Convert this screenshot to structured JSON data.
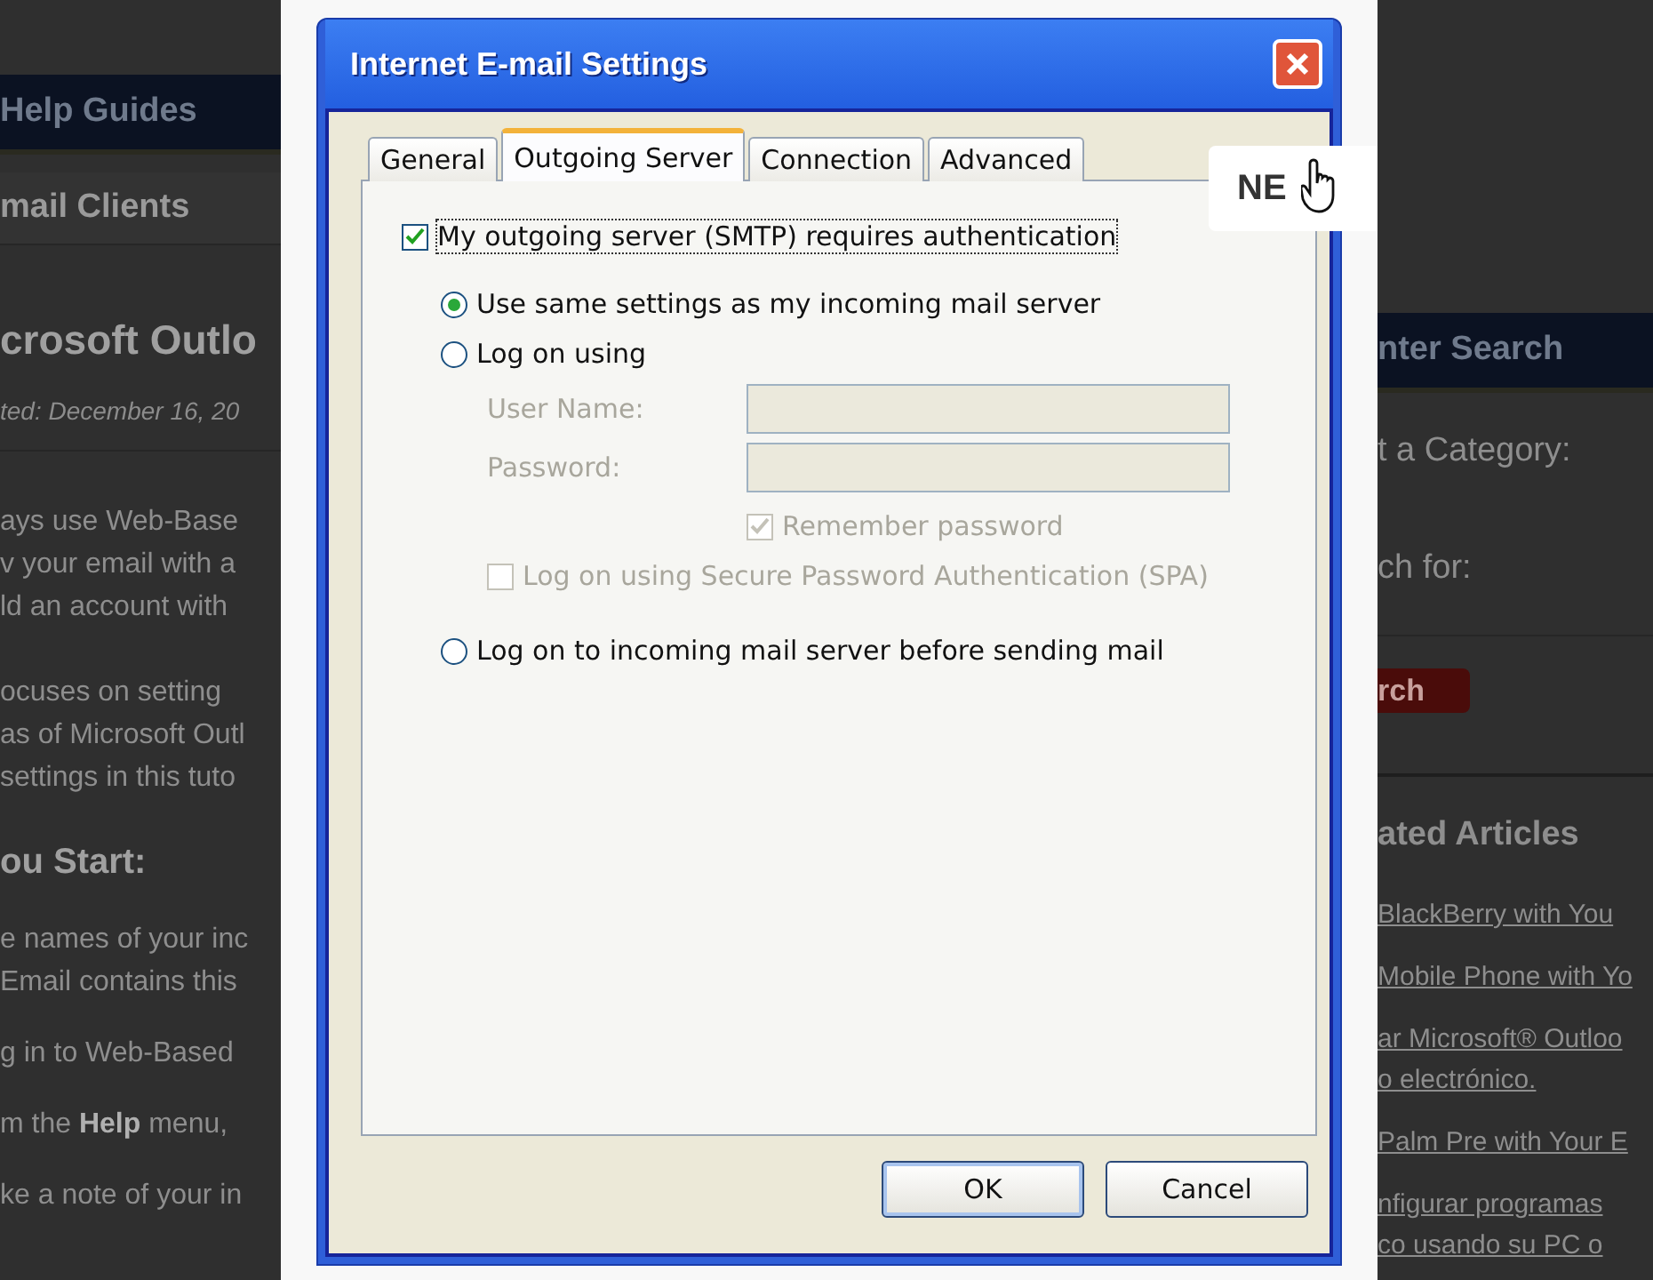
{
  "background_page": {
    "left_column": {
      "header": "Help Guides",
      "section_title": "mail Clients",
      "article_title": "crosoft Outlo",
      "date": "ted: December 16, 20",
      "paragraphs": [
        [
          "ays use Web-Base",
          "v your email with a",
          "ld an account with"
        ],
        [
          "ocuses on setting",
          "as of Microsoft Outl",
          "settings in this tuto"
        ]
      ],
      "heading": "ou Start:",
      "steps": [
        [
          "e names of your inc",
          "Email contains this"
        ],
        [
          "g in to Web-Based"
        ],
        [
          "m the **Help** menu,"
        ],
        [
          "ke a note of your in"
        ]
      ]
    },
    "right_column": {
      "header": "nter Search",
      "category_label": "t a Category:",
      "search_label": "ch for:",
      "search_button": "rch",
      "articles_heading": "ated Articles",
      "articles": [
        [
          "BlackBerry with You"
        ],
        [
          "Mobile Phone with Yo"
        ],
        [
          "ar Microsoft® Outloo",
          "o electrónico."
        ],
        [
          "Palm Pre with Your E"
        ],
        [
          "nfigurar programas",
          "co usando su PC o"
        ]
      ]
    }
  },
  "dialog": {
    "title": "Internet E-mail Settings",
    "tabs": [
      {
        "label": "General",
        "selected": false
      },
      {
        "label": "Outgoing Server",
        "selected": true
      },
      {
        "label": "Connection",
        "selected": false
      },
      {
        "label": "Advanced",
        "selected": false
      }
    ],
    "auth_checkbox": {
      "label": "My outgoing server (SMTP) requires authentication",
      "checked": true
    },
    "logon_options": [
      {
        "label": "Use same settings as my incoming mail server",
        "selected": true
      },
      {
        "label": "Log on using",
        "selected": false
      },
      {
        "label": "Log on to incoming mail server before sending mail",
        "selected": false
      }
    ],
    "credentials": {
      "disabled": true,
      "fields": [
        {
          "label": "User Name:"
        },
        {
          "label": "Password:"
        }
      ],
      "remember": {
        "label": "Remember password",
        "checked": true
      },
      "spa": {
        "label": "Log on using Secure Password Authentication (SPA)",
        "checked": false
      }
    },
    "buttons": [
      "OK",
      "Cancel"
    ]
  },
  "cursor_tip": {
    "text": "NE"
  }
}
